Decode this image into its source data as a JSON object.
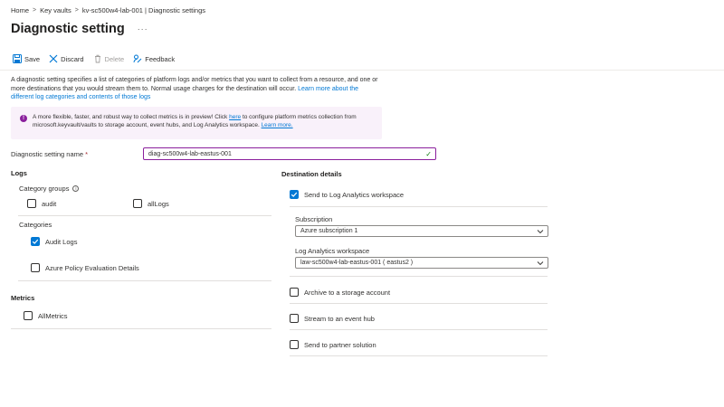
{
  "breadcrumb": {
    "items": [
      "Home",
      "Key vaults",
      "kv-sc500w4-lab-001 | Diagnostic settings"
    ],
    "separator": ">"
  },
  "page": {
    "title": "Diagnostic setting",
    "more_label": "···"
  },
  "toolbar": {
    "save_label": "Save",
    "discard_label": "Discard",
    "delete_label": "Delete",
    "feedback_label": "Feedback"
  },
  "description": {
    "text": "A diagnostic setting specifies a list of categories of platform logs and/or metrics that you want to collect from a resource, and one or more destinations that you would stream them to. Normal usage charges for the destination will occur.",
    "link": "Learn more about the different log categories and contents of those logs"
  },
  "info_banner": {
    "text_before": "A more flexible, faster, and robust way to collect metrics is in preview! Click",
    "here_link": "here",
    "text_after": "to configure platform metrics collection from microsoft.keyvault/vaults to storage account, event hubs, and Log Analytics workspace.",
    "learn_more": "Learn more."
  },
  "setting_name": {
    "label": "Diagnostic setting name",
    "required_mark": "*",
    "value": "diag-sc500w4-lab-eastus-001"
  },
  "logs": {
    "heading": "Logs",
    "category_groups_label": "Category groups",
    "category_groups": [
      {
        "label": "audit",
        "checked": false
      },
      {
        "label": "allLogs",
        "checked": false
      }
    ],
    "categories_label": "Categories",
    "categories": [
      {
        "label": "Audit Logs",
        "checked": true
      },
      {
        "label": "Azure Policy Evaluation Details",
        "checked": false
      }
    ]
  },
  "metrics": {
    "heading": "Metrics",
    "items": [
      {
        "label": "AllMetrics",
        "checked": false
      }
    ]
  },
  "destination": {
    "heading": "Destination details",
    "log_analytics": {
      "label": "Send to Log Analytics workspace",
      "checked": true
    },
    "subscription_label": "Subscription",
    "subscription_value": "Azure subscription 1",
    "workspace_label": "Log Analytics workspace",
    "workspace_value": "law-sc500w4-lab-eastus-001 ( eastus2 )",
    "storage": {
      "label": "Archive to a storage account",
      "checked": false
    },
    "event_hub": {
      "label": "Stream to an event hub",
      "checked": false
    },
    "partner": {
      "label": "Send to partner solution",
      "checked": false
    }
  },
  "colors": {
    "accent": "#0078d4",
    "focus_border": "#8a1f9c",
    "banner_bg": "#f9f1fa"
  }
}
